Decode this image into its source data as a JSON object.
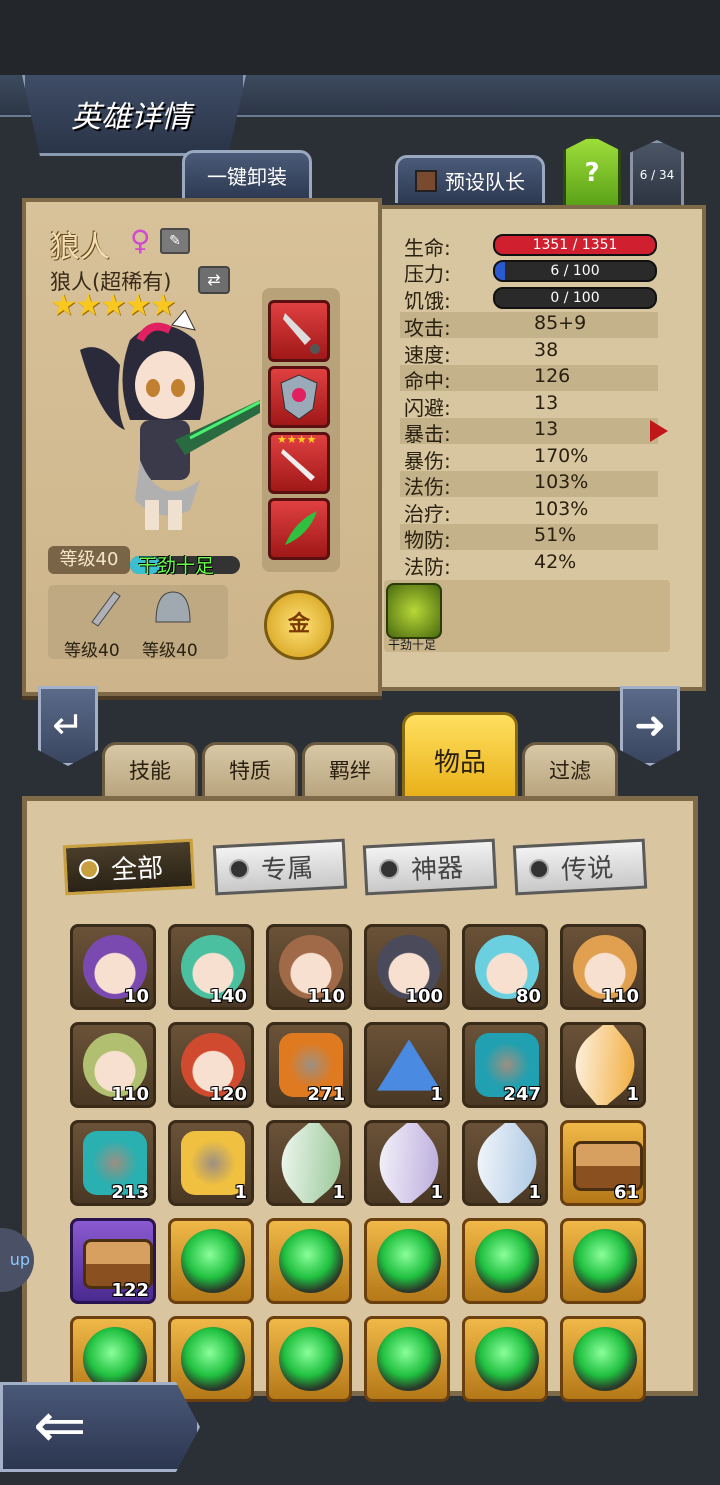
{
  "header": {
    "title": "英雄详情"
  },
  "top_buttons": {
    "unequip_all": "一键卸装",
    "preset_leader": "预设队长",
    "help": "?",
    "hero_count": "6 / 34"
  },
  "hero": {
    "name": "狼人",
    "gender_symbol": "♀",
    "rarity_text": "狼人(超稀有)",
    "stars": "★★★★★",
    "star_count": 5,
    "level": "等级40",
    "status": "干劲十足",
    "weapon_level": "等级40",
    "armor_level": "等级40",
    "gold_label": "金",
    "equip_slot_stars": "★★★★"
  },
  "stats": {
    "hp": {
      "label": "生命:",
      "value": "1351 / 1351",
      "fraction": 1.0,
      "color": "#d02030"
    },
    "stress": {
      "label": "压力:",
      "value": "6 / 100",
      "fraction": 0.06,
      "color": "#2a5ad0"
    },
    "hunger": {
      "label": "饥饿:",
      "value": "0 / 100",
      "fraction": 0.0,
      "color": "#888888"
    },
    "rows": [
      {
        "label": "攻击:",
        "value": "85+9"
      },
      {
        "label": "速度:",
        "value": "38"
      },
      {
        "label": "命中:",
        "value": "126"
      },
      {
        "label": "闪避:",
        "value": "13"
      },
      {
        "label": "暴击:",
        "value": "13"
      },
      {
        "label": "暴伤:",
        "value": "170%"
      },
      {
        "label": "法伤:",
        "value": "103%"
      },
      {
        "label": "治疗:",
        "value": "103%"
      },
      {
        "label": "物防:",
        "value": "51%"
      },
      {
        "label": "法防:",
        "value": "42%"
      }
    ]
  },
  "trait": {
    "label": "干劲十足"
  },
  "category_tabs": [
    "技能",
    "特质",
    "羁绊",
    "物品",
    "过滤"
  ],
  "active_category": "物品",
  "filter_tabs": [
    "全部",
    "专属",
    "神器",
    "传说"
  ],
  "active_filter": "全部",
  "inventory": [
    {
      "kind": "hero",
      "qty": "10",
      "color": "#7a4ab0"
    },
    {
      "kind": "hero",
      "qty": "140",
      "color": "#4ac0a0"
    },
    {
      "kind": "hero",
      "qty": "110",
      "color": "#a06a48"
    },
    {
      "kind": "hero",
      "qty": "100",
      "color": "#4a4a5a"
    },
    {
      "kind": "hero",
      "qty": "80",
      "color": "#6ad0e0"
    },
    {
      "kind": "hero",
      "qty": "110",
      "color": "#e0a050"
    },
    {
      "kind": "hero",
      "qty": "110",
      "color": "#b0c070"
    },
    {
      "kind": "hero",
      "qty": "120",
      "color": "#d04a30"
    },
    {
      "kind": "rune-gem",
      "qty": "271",
      "color": "#e07a20"
    },
    {
      "kind": "crystal-pile",
      "qty": "1",
      "color": "#4a8ae0"
    },
    {
      "kind": "dark-rune",
      "qty": "247",
      "color": "#20a0b0"
    },
    {
      "kind": "feather",
      "qty": "1",
      "color": "#f0a020"
    },
    {
      "kind": "potion",
      "qty": "213",
      "color": "#2ab0b0"
    },
    {
      "kind": "ticket",
      "qty": "1",
      "color": "#f0c040"
    },
    {
      "kind": "feather",
      "qty": "1",
      "color": "#8ac08a"
    },
    {
      "kind": "feather",
      "qty": "1",
      "color": "#b0a0d8"
    },
    {
      "kind": "feather",
      "qty": "1",
      "color": "#a0c0e0"
    },
    {
      "kind": "chest",
      "qty": "61",
      "color": "#c08040"
    },
    {
      "kind": "chest",
      "qty": "122",
      "color": "#c08040"
    },
    {
      "kind": "green-orb",
      "qty": "",
      "color": "#20c040"
    },
    {
      "kind": "green-orb",
      "qty": "",
      "color": "#20c040"
    },
    {
      "kind": "green-orb",
      "qty": "",
      "color": "#20c040"
    },
    {
      "kind": "green-orb",
      "qty": "",
      "color": "#20c040"
    },
    {
      "kind": "green-orb",
      "qty": "",
      "color": "#20c040"
    },
    {
      "kind": "green-orb",
      "qty": "",
      "color": "#20c040"
    },
    {
      "kind": "green-orb",
      "qty": "",
      "color": "#20c040"
    },
    {
      "kind": "green-orb",
      "qty": "",
      "color": "#20c040"
    },
    {
      "kind": "green-orb",
      "qty": "",
      "color": "#20c040"
    },
    {
      "kind": "green-orb",
      "qty": "",
      "color": "#20c040"
    },
    {
      "kind": "green-orb",
      "qty": "",
      "color": "#20c040"
    }
  ],
  "side_tab": "up"
}
